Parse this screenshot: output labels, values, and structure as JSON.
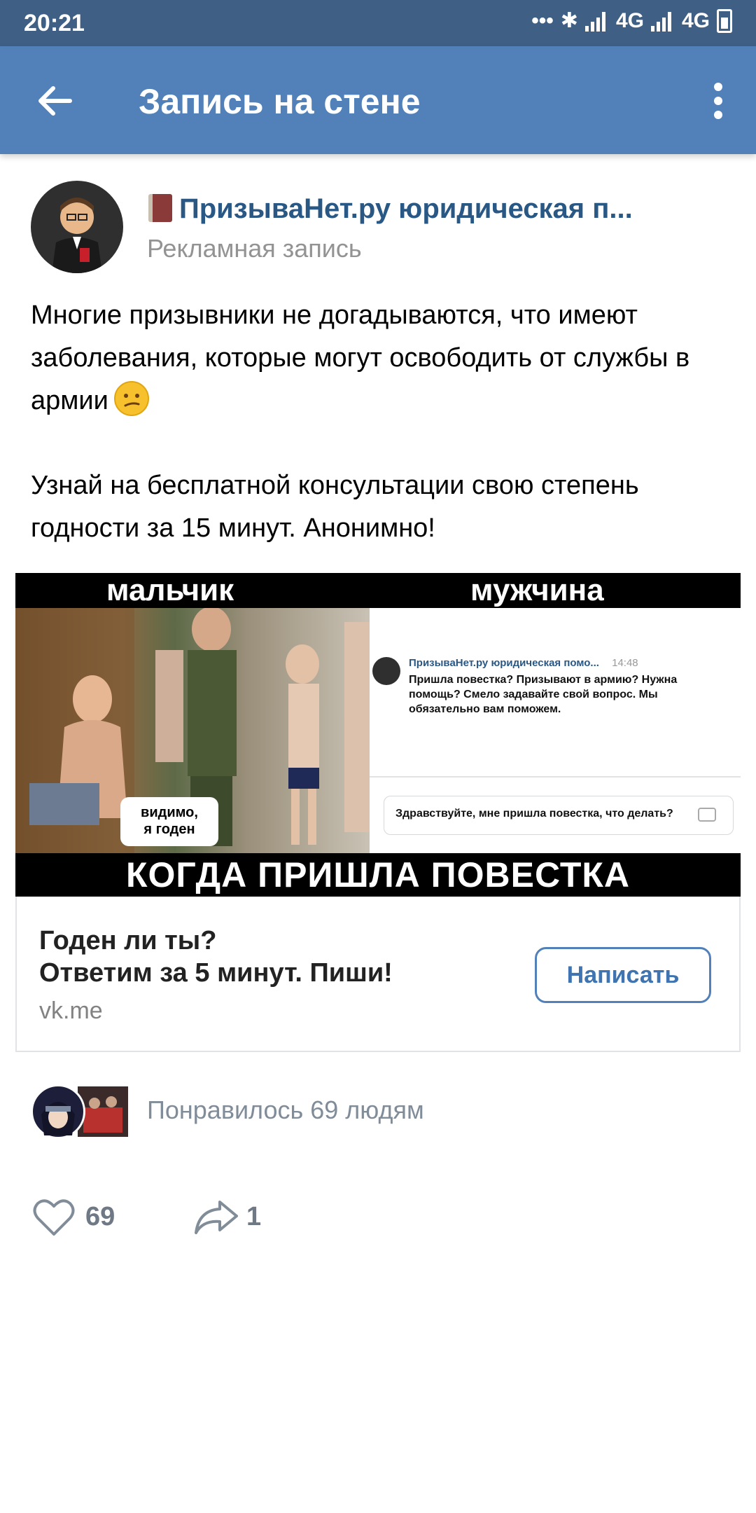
{
  "status_bar": {
    "time": "20:21",
    "network1": "4G",
    "network2": "4G"
  },
  "app_bar": {
    "title": "Запись на стене",
    "back_icon": "arrow-left-icon",
    "menu_icon": "more-vertical-icon"
  },
  "post": {
    "author_icon": "book-emoji",
    "author": "ПризываНет.ру юридическая п...",
    "label": "Рекламная запись",
    "text_p1": "Многие призывники не догадываются, что имеют заболевания, которые могут освободить от службы в армии",
    "text_p2": "Узнай на бесплатной консультации свою степень годности за 15 минут. Анонимно!",
    "emoji": "confused-face"
  },
  "ad_image": {
    "left_caption": "мальчик",
    "right_caption": "мужчина",
    "bottom_caption": "КОГДА ПРИШЛА ПОВЕСТКА",
    "bubble_text": "видимо,\nя годен",
    "chat_author": "ПризываНет.ру юридическая помо...",
    "chat_time": "14:48",
    "chat_message": "Пришла повестка? Призывают в армию? Нужна помощь? Смело задавайте свой вопрос. Мы обязательно вам поможем.",
    "chat_input": "Здравствуйте, мне пришла повестка, что делать?"
  },
  "ad_card": {
    "headline1": "Годен ли ты?",
    "headline2": "Ответим за 5 минут. Пиши!",
    "domain": "vk.me",
    "button": "Написать"
  },
  "likes": {
    "text": "Понравилось 69 людям"
  },
  "actions": {
    "like_count": "69",
    "share_count": "1"
  },
  "colors": {
    "status_bar": "#3f5f85",
    "app_bar": "#5181b8",
    "link": "#2a5885",
    "muted": "#818c99"
  }
}
